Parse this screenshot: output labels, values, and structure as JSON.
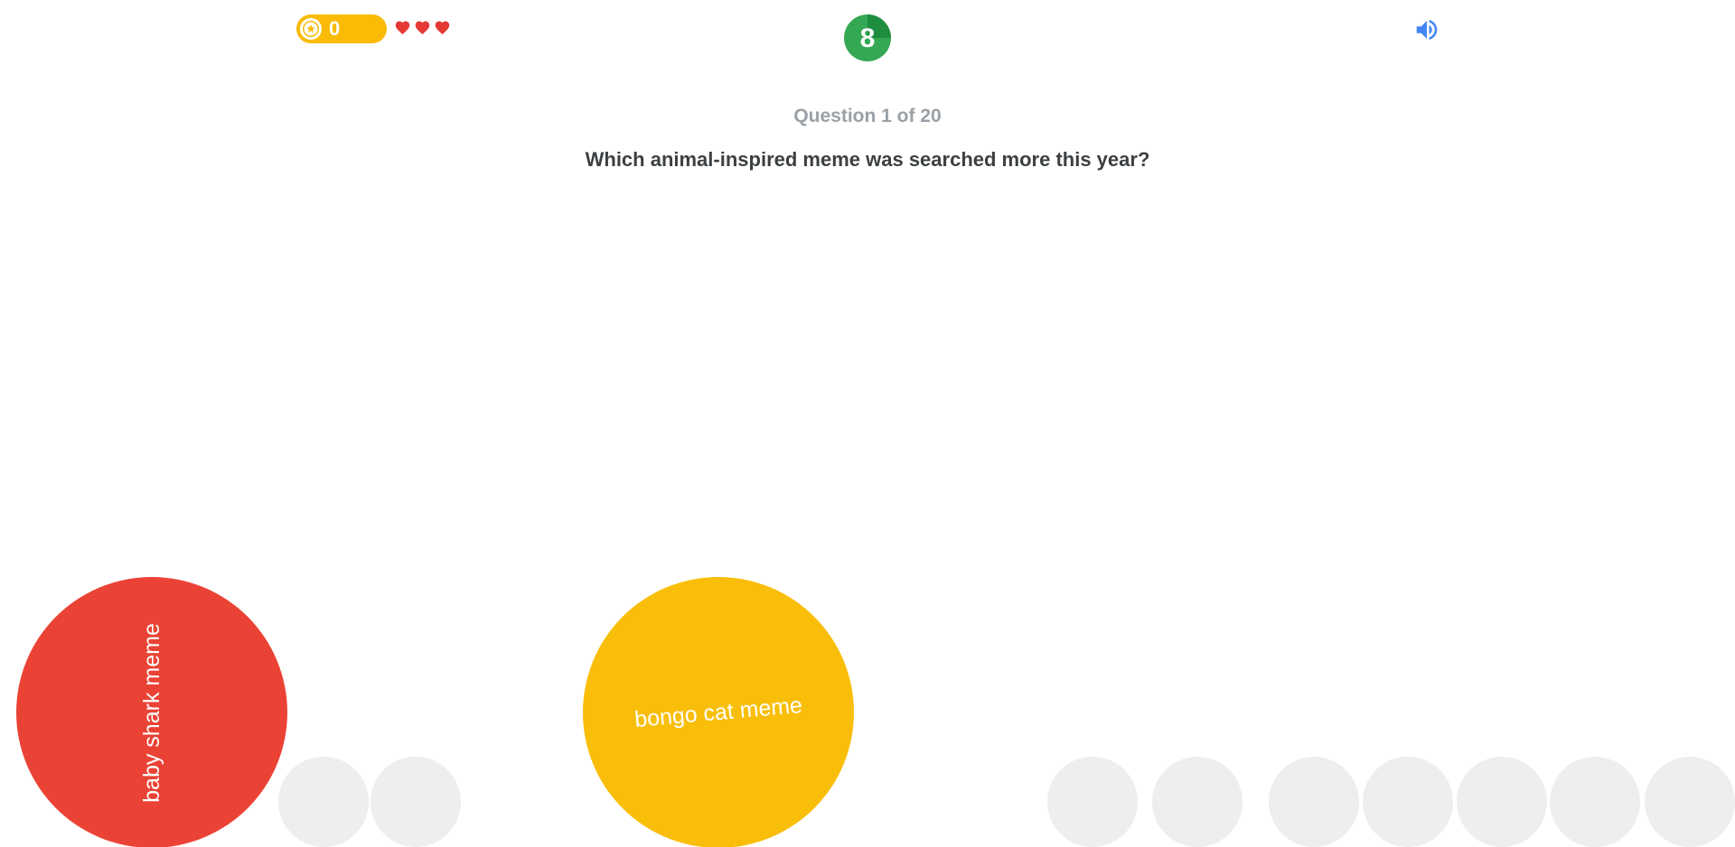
{
  "hud": {
    "score": "0",
    "lives": 3,
    "timer": "8",
    "icons": {
      "score_badge": "star-icon",
      "life": "heart-icon",
      "sound": "speaker-icon"
    }
  },
  "question": {
    "counter": "Question 1 of 20",
    "text": "Which animal-inspired meme was searched more this year?"
  },
  "answers": [
    {
      "label": "baby shark meme",
      "color": "#ea4335"
    },
    {
      "label": "bongo cat meme",
      "color": "#f9be09"
    }
  ],
  "colors": {
    "score_pill": "#f9bb06",
    "heart": "#e53935",
    "timer": "#34a853",
    "sound_icon": "#4285f4",
    "question_counter": "#9aa0a6",
    "question_text": "#3c4043",
    "placeholder_ball": "#eeeeee"
  }
}
